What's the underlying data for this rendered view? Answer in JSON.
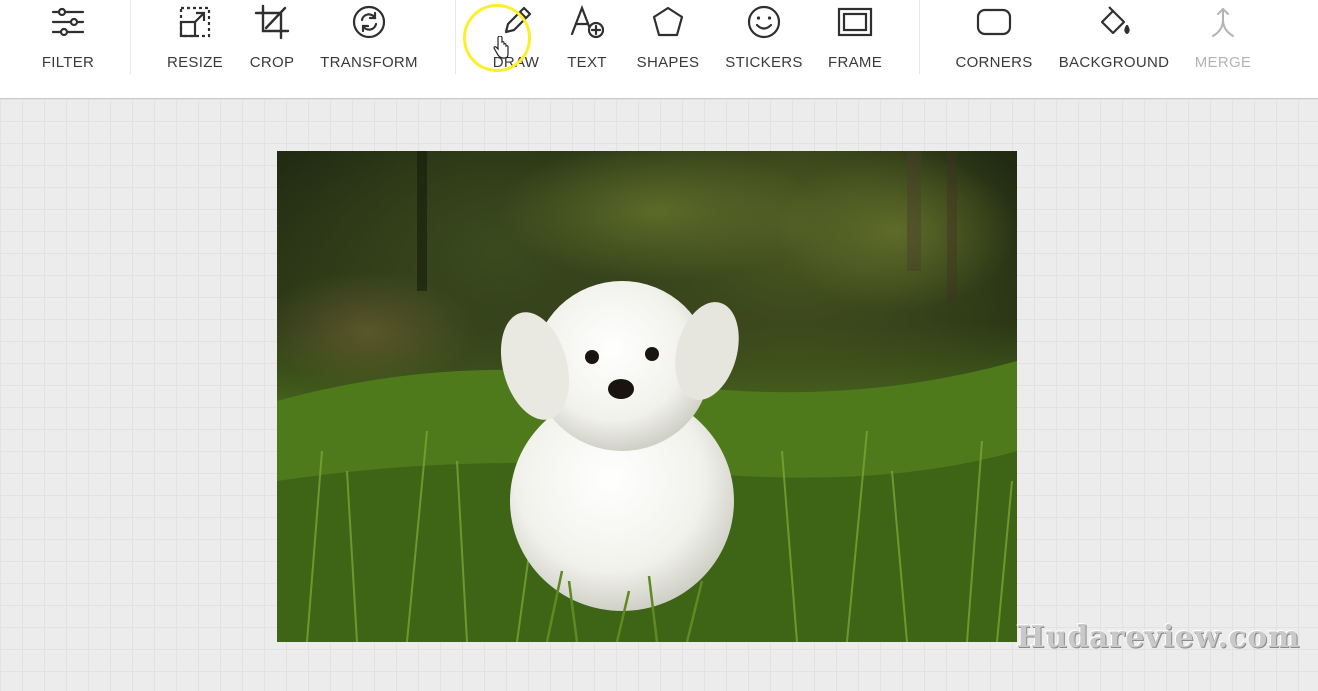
{
  "toolbar": {
    "tools": [
      {
        "id": "filter",
        "label": "FILTER",
        "icon": "sliders-icon"
      },
      {
        "id": "resize",
        "label": "RESIZE",
        "icon": "resize-icon"
      },
      {
        "id": "crop",
        "label": "CROP",
        "icon": "crop-icon"
      },
      {
        "id": "transform",
        "label": "TRANSFORM",
        "icon": "rotate-icon"
      },
      {
        "id": "draw",
        "label": "DRAW",
        "icon": "pencil-icon"
      },
      {
        "id": "text",
        "label": "TEXT",
        "icon": "text-add-icon"
      },
      {
        "id": "shapes",
        "label": "SHAPES",
        "icon": "pentagon-icon"
      },
      {
        "id": "stickers",
        "label": "STICKERS",
        "icon": "smiley-icon"
      },
      {
        "id": "frame",
        "label": "FRAME",
        "icon": "frame-icon"
      },
      {
        "id": "corners",
        "label": "CORNERS",
        "icon": "rounded-square-icon"
      },
      {
        "id": "background",
        "label": "BACKGROUND",
        "icon": "paint-bucket-icon"
      },
      {
        "id": "merge",
        "label": "MERGE",
        "icon": "merge-icon",
        "disabled": true
      }
    ]
  },
  "canvas": {
    "image_subject": "white-puppy-in-grass"
  },
  "watermark": "Hudareview.com",
  "colors": {
    "toolbar_bg": "#ffffff",
    "icon": "#2f2f2f",
    "label": "#3a3a3a",
    "disabled": "#b3b3b3",
    "cursor_highlight": "#ffee2a",
    "canvas_bg": "#ececec"
  }
}
